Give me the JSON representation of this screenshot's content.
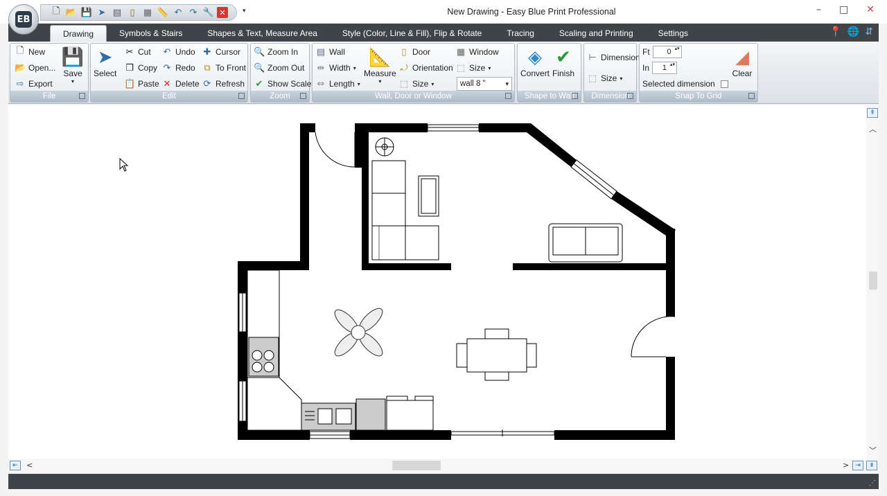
{
  "app": {
    "title": "New Drawing - Easy Blue Print Professional",
    "orb_logo": "EB"
  },
  "qat": {
    "icons": [
      "new-icon",
      "open-icon",
      "save-icon",
      "select-icon",
      "wall-icon",
      "door-icon",
      "window-icon",
      "measure-icon",
      "undo-icon",
      "redo-icon",
      "wrench-icon",
      "close-icon"
    ]
  },
  "tabs": [
    "Drawing",
    "Symbols & Stairs",
    "Shapes & Text, Measure Area",
    "Style (Color, Line & Fill), Flip & Rotate",
    "Tracing",
    "Scaling and Printing",
    "Settings"
  ],
  "active_tab": "Drawing",
  "ribbon": {
    "file": {
      "label": "File",
      "new": "New",
      "open": "Open...",
      "export": "Export",
      "save": "Save"
    },
    "edit": {
      "label": "Edit",
      "select": "Select",
      "cut": "Cut",
      "copy": "Copy",
      "paste": "Paste",
      "undo": "Undo",
      "redo": "Redo",
      "delete": "Delete",
      "cursor": "Cursor",
      "to_front": "To Front",
      "refresh": "Refresh"
    },
    "zoom": {
      "label": "Zoom",
      "zoom_in": "Zoom In",
      "zoom_out": "Zoom Out",
      "show_scale": "Show Scale"
    },
    "wall": {
      "label": "Wall, Door or Window",
      "wall": "Wall",
      "width": "Width",
      "length": "Length",
      "measure": "Measure",
      "door": "Door",
      "orientation": "Orientation",
      "size": "Size",
      "window": "Window",
      "window_size": "Size",
      "combo_value": "wall 8 \""
    },
    "shape_to_wall": {
      "label": "Shape to Wall",
      "convert": "Convert",
      "finish": "Finish"
    },
    "dimension": {
      "label": "Dimension",
      "dimension": "Dimension",
      "size": "Size"
    },
    "snap": {
      "label": "Snap To Grid",
      "ft_label": "Ft",
      "ft_value": "0",
      "in_label": "In",
      "in_value": "1",
      "selected_dimension": "Selected dimension",
      "clear": "Clear"
    }
  },
  "colors": {
    "ribbon_dark": "#3e4448",
    "wall": "#000000",
    "accent": "#2f6ea8"
  }
}
